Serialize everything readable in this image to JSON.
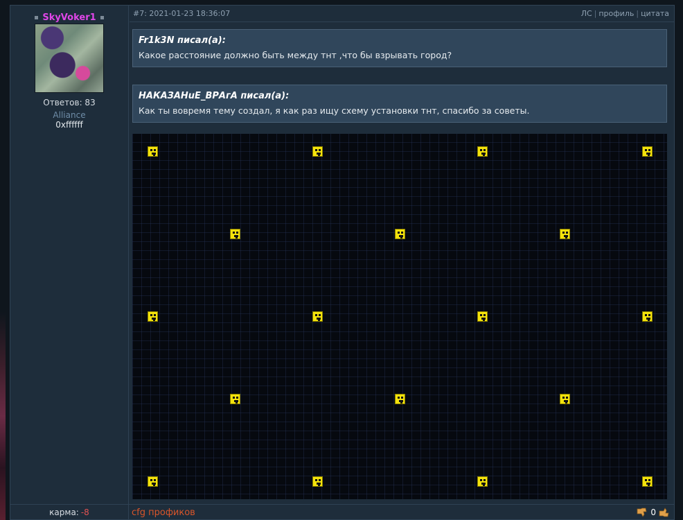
{
  "post": {
    "author": {
      "name": "SkyVoker1",
      "stat": "Ответов: 83",
      "group": "Alliance",
      "signature": "0xffffff"
    },
    "header": {
      "meta": "#7: 2021-01-23 18:36:07",
      "links": [
        "ЛС",
        "профиль",
        "цитата"
      ]
    },
    "quotes": [
      {
        "author": "Fr1k3N писал(а):",
        "text": "Какое расстояние должно быть между тнт ,что бы взрывать город?"
      },
      {
        "author": "НАКАЗАНuЕ_ВРАгА писал(а):",
        "text": "Как ты вовремя тему создал, я как раз ищу схему установки тнт, спасибо за советы."
      }
    ],
    "footer": {
      "karma_label": "карма:",
      "karma_value": "-8",
      "link": "cfg профиков",
      "rating": "0"
    }
  },
  "icons": {
    "dislike": "thumb-down-icon",
    "like": "thumb-up-icon"
  },
  "colors": {
    "author_name": "#e046e8",
    "group": "#6f8da8",
    "karma_negative": "#e05252",
    "footer_link": "#d9552a",
    "tnt_block": "#f4e30c"
  }
}
